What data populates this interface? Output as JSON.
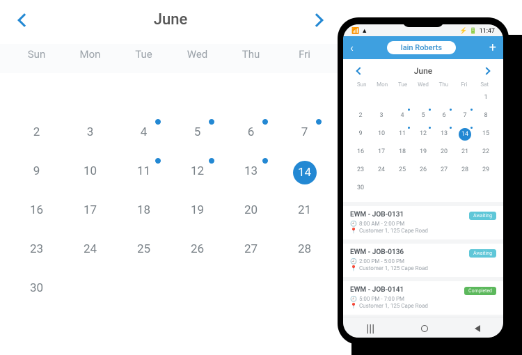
{
  "big": {
    "month": "June",
    "dows": [
      "Sun",
      "Mon",
      "Tue",
      "Wed",
      "Thu",
      "Fri"
    ],
    "rows": [
      [
        {
          "n": ""
        },
        {
          "n": ""
        },
        {
          "n": ""
        },
        {
          "n": ""
        },
        {
          "n": ""
        },
        {
          "n": ""
        }
      ],
      [
        {
          "n": "2"
        },
        {
          "n": "3"
        },
        {
          "n": "4",
          "d": 1
        },
        {
          "n": "5",
          "d": 1
        },
        {
          "n": "6",
          "d": 1
        },
        {
          "n": "7",
          "d": 1
        }
      ],
      [
        {
          "n": "9"
        },
        {
          "n": "10"
        },
        {
          "n": "11",
          "d": 1
        },
        {
          "n": "12",
          "d": 1
        },
        {
          "n": "13",
          "d": 1
        },
        {
          "n": "14",
          "d": 1,
          "sel": 1
        }
      ],
      [
        {
          "n": "16"
        },
        {
          "n": "17"
        },
        {
          "n": "18"
        },
        {
          "n": "19"
        },
        {
          "n": "20"
        },
        {
          "n": "21"
        }
      ],
      [
        {
          "n": "23"
        },
        {
          "n": "24"
        },
        {
          "n": "25"
        },
        {
          "n": "26"
        },
        {
          "n": "27"
        },
        {
          "n": "28"
        }
      ],
      [
        {
          "n": "30"
        },
        {
          "n": ""
        },
        {
          "n": ""
        },
        {
          "n": ""
        },
        {
          "n": ""
        },
        {
          "n": ""
        }
      ]
    ]
  },
  "phone": {
    "status_time": "11:47",
    "user": "Iain Roberts",
    "month": "June",
    "dows": [
      "Sun",
      "Mon",
      "Tue",
      "Wed",
      "Thu",
      "Fri",
      "Sat"
    ],
    "rows": [
      [
        {
          "n": ""
        },
        {
          "n": ""
        },
        {
          "n": ""
        },
        {
          "n": ""
        },
        {
          "n": ""
        },
        {
          "n": ""
        },
        {
          "n": "1"
        }
      ],
      [
        {
          "n": "2"
        },
        {
          "n": "3"
        },
        {
          "n": "4",
          "d": 1
        },
        {
          "n": "5",
          "d": 1
        },
        {
          "n": "6",
          "d": 1
        },
        {
          "n": "7",
          "d": 1
        },
        {
          "n": "8"
        }
      ],
      [
        {
          "n": "9"
        },
        {
          "n": "10"
        },
        {
          "n": "11",
          "d": 1
        },
        {
          "n": "12",
          "d": 1
        },
        {
          "n": "13",
          "d": 1
        },
        {
          "n": "14",
          "d": 1,
          "sel": 1
        },
        {
          "n": "15"
        }
      ],
      [
        {
          "n": "16"
        },
        {
          "n": "17"
        },
        {
          "n": "18"
        },
        {
          "n": "19"
        },
        {
          "n": "20"
        },
        {
          "n": "21"
        },
        {
          "n": "22"
        }
      ],
      [
        {
          "n": "23"
        },
        {
          "n": "24"
        },
        {
          "n": "25"
        },
        {
          "n": "26"
        },
        {
          "n": "27"
        },
        {
          "n": "28"
        },
        {
          "n": "29"
        }
      ],
      [
        {
          "n": "30"
        },
        {
          "n": ""
        },
        {
          "n": ""
        },
        {
          "n": ""
        },
        {
          "n": ""
        },
        {
          "n": ""
        },
        {
          "n": ""
        }
      ]
    ],
    "jobs": [
      {
        "title": "EWM - JOB-0131",
        "time": "8:00 AM - 2:00 PM",
        "loc": "Customer 1, 125 Cape Road",
        "status": "Awaiting",
        "cls": "await"
      },
      {
        "title": "EWM - JOB-0136",
        "time": "2:00 PM - 5:00 PM",
        "loc": "Customer 1, 125 Cape Road",
        "status": "Awaiting",
        "cls": "await"
      },
      {
        "title": "EWM - JOB-0141",
        "time": "5:00 PM - 7:00 PM",
        "loc": "Customer 1, 125 Cape Road",
        "status": "Completed",
        "cls": "done"
      }
    ],
    "clock_icon": "🕘",
    "pin_icon": "📍"
  }
}
